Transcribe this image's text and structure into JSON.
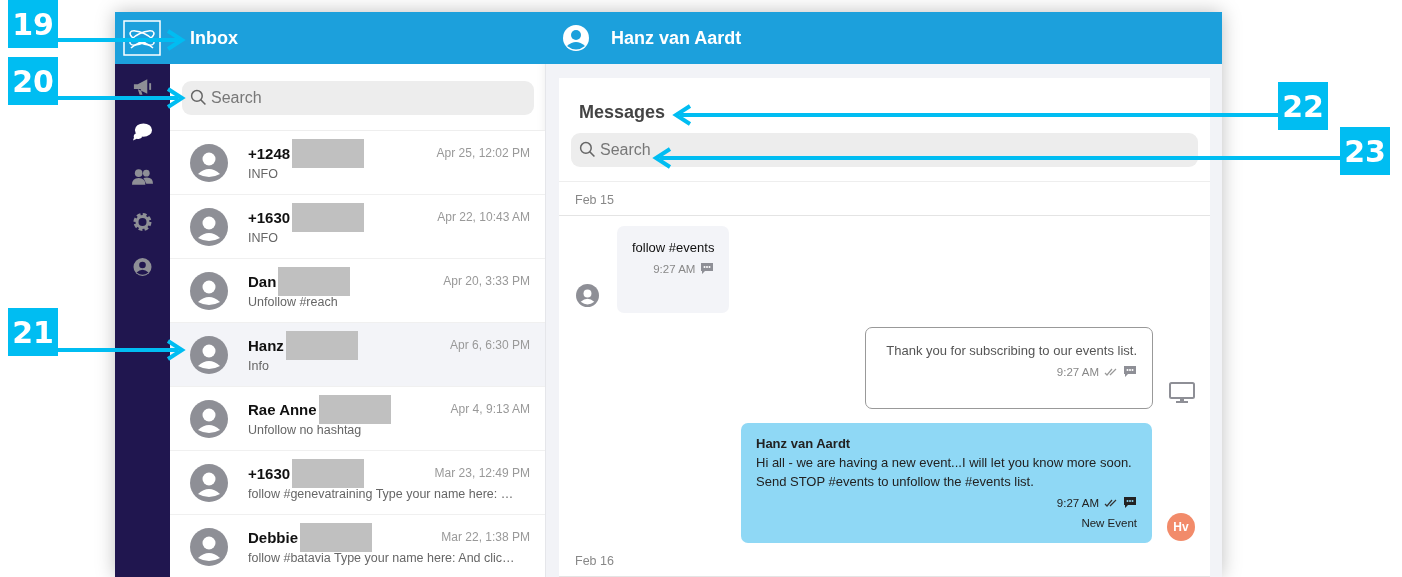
{
  "header": {
    "title": "Inbox",
    "contact_name": "Hanz van Aardt"
  },
  "nav_items": [
    {
      "kind": "campaigns",
      "selected": false
    },
    {
      "kind": "messages",
      "selected": true
    },
    {
      "kind": "contacts",
      "selected": false
    },
    {
      "kind": "settings",
      "selected": false
    },
    {
      "kind": "account",
      "selected": false
    }
  ],
  "conversation_search": {
    "placeholder": "Search"
  },
  "conversations": [
    {
      "name": "+1248",
      "redacted": true,
      "date": "Apr 25, 12:02 PM",
      "preview": "INFO",
      "selected": false
    },
    {
      "name": "+1630",
      "redacted": true,
      "date": "Apr 22, 10:43 AM",
      "preview": "INFO",
      "selected": false
    },
    {
      "name": "Dan",
      "redacted": true,
      "date": "Apr 20, 3:33 PM",
      "preview": "Unfollow #reach",
      "selected": false
    },
    {
      "name": "Hanz",
      "redacted": true,
      "date": "Apr 6, 6:30 PM",
      "preview": "Info",
      "selected": true
    },
    {
      "name": "Rae Anne",
      "redacted": true,
      "date": "Apr 4, 9:13 AM",
      "preview": "Unfollow no hashtag",
      "selected": false
    },
    {
      "name": "+1630",
      "redacted": true,
      "date": "Mar 23, 12:49 PM",
      "preview": "follow #genevatraining Type your name here: …",
      "selected": false
    },
    {
      "name": "Debbie",
      "redacted": true,
      "date": "Mar 22, 1:38 PM",
      "preview": "follow #batavia Type your name here: And clic…",
      "selected": false
    }
  ],
  "messages_panel": {
    "title": "Messages",
    "search": {
      "placeholder": "Search"
    },
    "timeline": [
      {
        "kind": "date",
        "text": "Feb 15"
      },
      {
        "kind": "received",
        "text": "follow #events",
        "time": "9:27 AM"
      },
      {
        "kind": "automated",
        "text": "Thank you for subscribing to our events list.",
        "time": "9:27 AM"
      },
      {
        "kind": "agent",
        "author": "Hanz van Aardt",
        "text": "Hi all - we are having a new event...I will let you know more soon.\nSend STOP #events to unfollow the #events list.",
        "time": "9:27 AM",
        "tag": "New Event",
        "initials": "Hv"
      },
      {
        "kind": "date",
        "text": "Feb 16"
      }
    ]
  },
  "callouts": [
    {
      "label": "19"
    },
    {
      "label": "20"
    },
    {
      "label": "21"
    },
    {
      "label": "22"
    },
    {
      "label": "23"
    }
  ]
}
